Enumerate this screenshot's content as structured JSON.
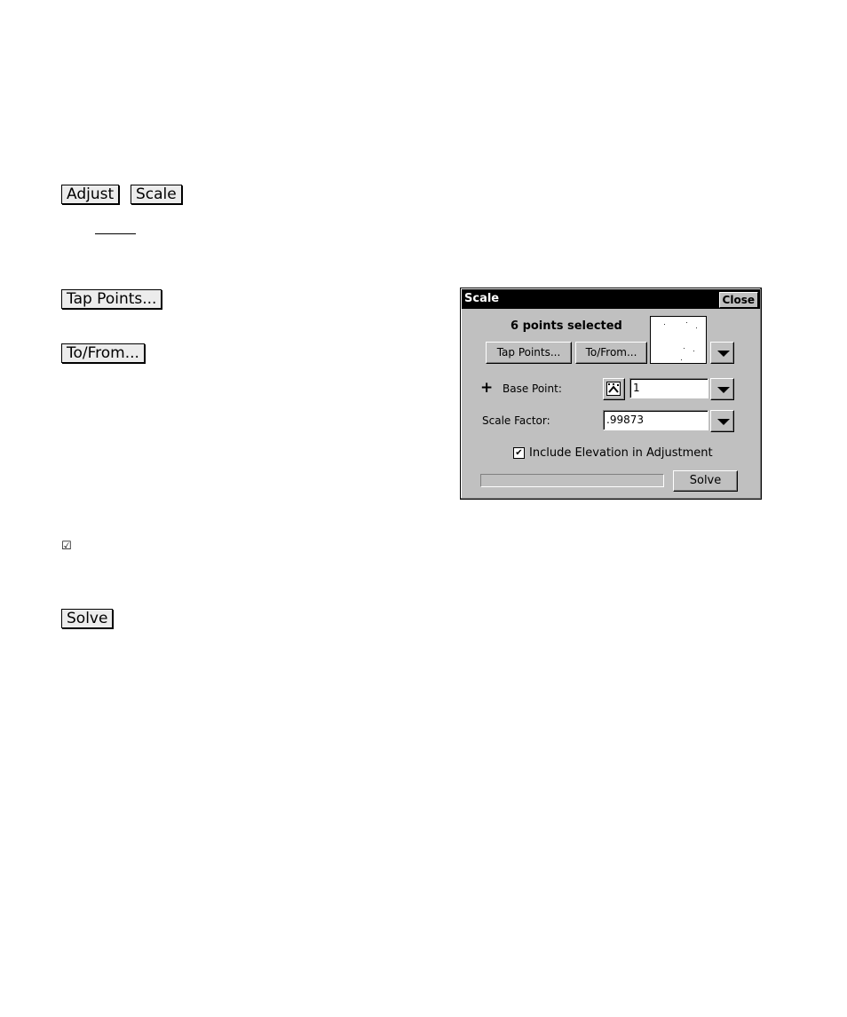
{
  "document": {
    "adjust_button": "Adjust",
    "scale_button": "Scale",
    "tap_points_button": "Tap Points...",
    "to_from_button": "To/From...",
    "checkbox_glyph": "☑",
    "solve_button": "Solve"
  },
  "dialog": {
    "title": "Scale",
    "close_label": "Close",
    "points_selected": "6 points selected",
    "tap_points_label": "Tap Points...",
    "to_from_label": "To/From...",
    "base_point_label": "Base Point:",
    "base_point_value": "1",
    "scale_factor_label": "Scale Factor:",
    "scale_factor_value": ".99873",
    "include_elevation_label": "Include Elevation in Adjustment",
    "include_elevation_checked": true,
    "solve_label": "Solve",
    "progress": 0
  }
}
